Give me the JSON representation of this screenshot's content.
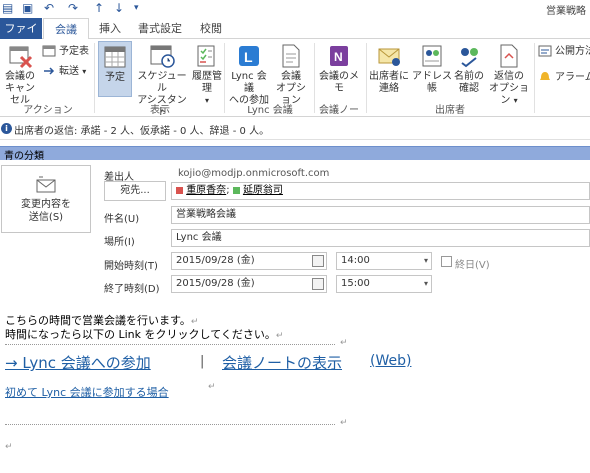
{
  "window": {
    "title": "営業戦略"
  },
  "tabs": [
    {
      "label": "ファイル"
    },
    {
      "label": "会議"
    },
    {
      "label": "挿入"
    },
    {
      "label": "書式設定"
    },
    {
      "label": "校閲"
    }
  ],
  "ribbon": {
    "action_group": {
      "label": "アクション",
      "cancel": "会議の\nキャンセル",
      "calendar": "予定表",
      "forward": "転送"
    },
    "show_group": {
      "label": "表示",
      "appointment": "予定",
      "scheduling": "スケジュール\nアシスタント",
      "tracking": "履歴管理"
    },
    "lync_group": {
      "label": "Lync 会議",
      "join": "Lync 会議\nへの参加",
      "options": "会議\nオプション"
    },
    "notes_group": {
      "label": "会議ノート",
      "notes": "会議のメモ"
    },
    "attendees_group": {
      "label": "出席者",
      "contact": "出席者に\n連絡",
      "address_book": "アドレス帳",
      "check_names": "名前の\n確認",
      "response_options": "返信の\nオプション"
    },
    "extra": {
      "public": "公開方法",
      "alarm": "アラーム"
    }
  },
  "info_bar": {
    "text": "出席者の返信: 承諾 - 2 人、仮承諾 - 0 人、辞退 - 0 人。"
  },
  "category_bar": {
    "text": "青の分類"
  },
  "form": {
    "send_update": "変更内容を\n送信(S)",
    "from_label": "差出人",
    "from_value": "kojio@modjp.onmicrosoft.com",
    "to_button": "宛先...",
    "attendees": [
      "重原香奈",
      "延原翁司"
    ],
    "attendee_colors": [
      "#d9534f",
      "#5cb85c"
    ],
    "subject_label": "件名(U)",
    "subject_value": "営業戦略会議",
    "location_label": "場所(I)",
    "location_value": "Lync 会議",
    "start_label": "開始時刻(T)",
    "start_date": "2015/09/28 (金)",
    "start_time": "14:00",
    "allday_label": "終日(V)",
    "end_label": "終了時刻(D)",
    "end_date": "2015/09/28 (金)",
    "end_time": "15:00"
  },
  "body": {
    "line1": "こちらの時間で営業会議を行います。",
    "line2": "時間になったら以下の Link をクリックしてください。",
    "join_link": "→ Lync 会議への参加",
    "separator": "|",
    "notes_link": "会議ノートの表示",
    "web_link": "(Web)",
    "first_time_link": "初めて Lync 会議に参加する場合",
    "para_mark": "↵"
  }
}
